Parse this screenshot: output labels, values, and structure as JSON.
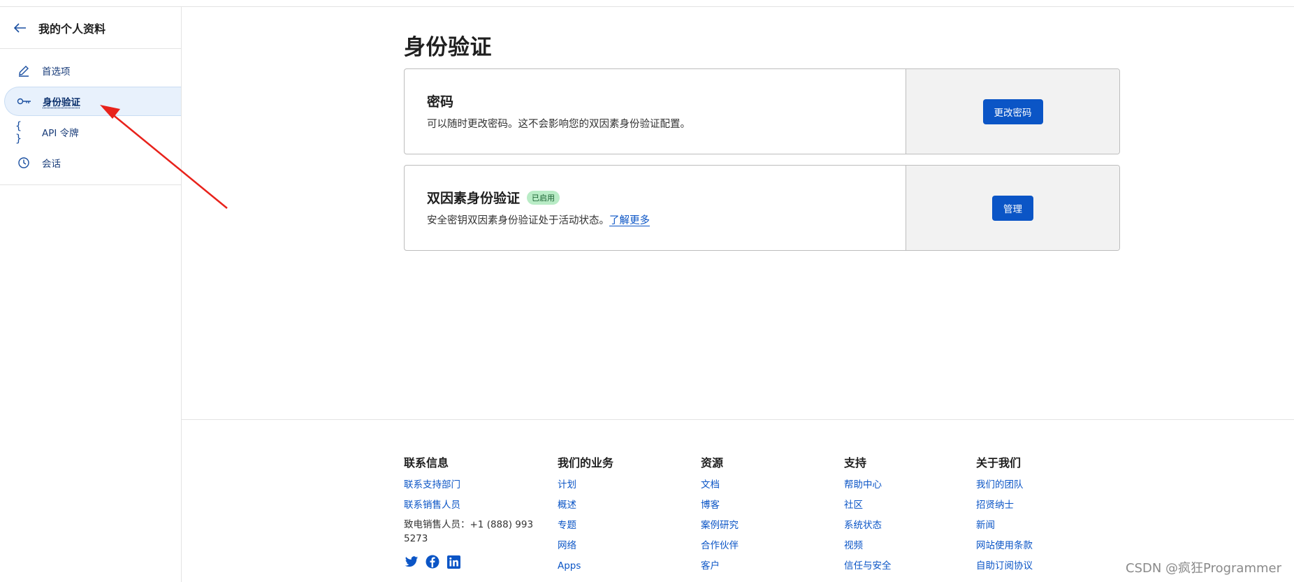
{
  "sidebar": {
    "title": "我的个人资料",
    "items": [
      {
        "label": "首选项",
        "icon": "pencil-icon"
      },
      {
        "label": "身份验证",
        "icon": "key-icon"
      },
      {
        "label": "API 令牌",
        "icon": "braces-icon"
      },
      {
        "label": "会话",
        "icon": "clock-icon"
      }
    ]
  },
  "main": {
    "title": "身份验证",
    "password_card": {
      "title": "密码",
      "description": "可以随时更改密码。这不会影响您的双因素身份验证配置。",
      "button": "更改密码"
    },
    "twofa_card": {
      "title": "双因素身份验证",
      "badge": "已启用",
      "description": "安全密钥双因素身份验证处于活动状态。",
      "link": "了解更多",
      "button": "管理"
    }
  },
  "footer": {
    "contact": {
      "heading": "联系信息",
      "links": [
        "联系支持部门",
        "联系销售人员"
      ],
      "phone": "致电销售人员：+1 (888) 993 5273"
    },
    "business": {
      "heading": "我们的业务",
      "links": [
        "计划",
        "概述",
        "专题",
        "网络",
        "Apps"
      ]
    },
    "resources": {
      "heading": "资源",
      "links": [
        "文档",
        "博客",
        "案例研究",
        "合作伙伴",
        "客户"
      ]
    },
    "support": {
      "heading": "支持",
      "links": [
        "帮助中心",
        "社区",
        "系统状态",
        "视频",
        "信任与安全"
      ]
    },
    "about": {
      "heading": "关于我们",
      "links": [
        "我们的团队",
        "招贤纳士",
        "新闻",
        "网站使用条款",
        "自助订阅协议"
      ]
    }
  },
  "watermark": "CSDN @疯狂Programmer",
  "colors": {
    "accent": "#0b55c6",
    "badge_bg": "#b9ecc6",
    "annotation_arrow": "#e8221b"
  }
}
